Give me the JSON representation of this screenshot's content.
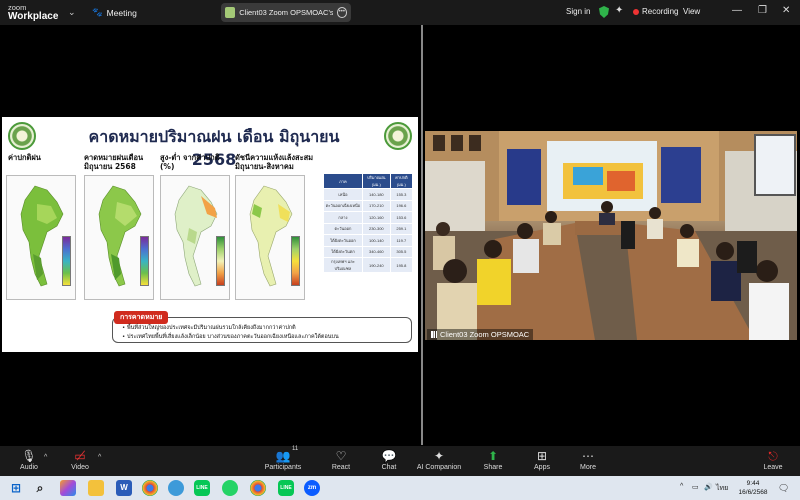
{
  "topbar": {
    "logo_line1": "zoom",
    "logo_line2": "Workplace",
    "meeting_label": "Meeting",
    "share_title": "Client03 Zoom OPSMOAC's scre",
    "signin": "Sign in",
    "recording": "Recording",
    "view": "View"
  },
  "slide": {
    "title": "คาดหมายปริมาณฝน เดือน มิถุนายน 2568",
    "panels": [
      {
        "label": "ค่าปกติฝน"
      },
      {
        "label": "คาดหมายฝนเดือน มิถุนายน 2568"
      },
      {
        "label": "สูง-ต่ำ จากค่าปกติ (%)"
      },
      {
        "label": "ดัชนีความแห้งแล้งสะสม มิถุนายน-สิงหาคม"
      }
    ],
    "table": {
      "headers": [
        "ภาค",
        "ปริมาณฝน (มม.)",
        "ค่าปกติ (มม.)"
      ],
      "rows": [
        [
          "เหนือ",
          "140-180",
          "155.3"
        ],
        [
          "ตะวันออกเฉียงเหนือ",
          "170-210",
          "196.6"
        ],
        [
          "กลาง",
          "120-160",
          "153.6"
        ],
        [
          "ตะวันออก",
          "230-300",
          "259.1"
        ],
        [
          "ใต้ฝั่งตะวันออก",
          "100-140",
          "119.7"
        ],
        [
          "ใต้ฝั่งตะวันตก",
          "340-460",
          "305.5"
        ],
        [
          "กรุงเทพฯ และปริมณฑล",
          "190-240",
          "195.8"
        ]
      ]
    },
    "forecast_tag": "การคาดหมาย",
    "forecast_line1": "• พื้นที่ส่วนใหญ่ของประเทศจะมีปริมาณฝนรวมใกล้เคียงถึงมากกว่าค่าปกติ",
    "forecast_line2": "• ประเทศไทยพื้นที่เสี่ยงแล้งเล็กน้อย บางส่วนของภาคตะวันออกเฉียงเหนือและภาคใต้ตอนบน"
  },
  "camera": {
    "participant_name": "Client03 Zoom OPSMOAC"
  },
  "toolbar": {
    "audio": "Audio",
    "video": "Video",
    "participants": "Participants",
    "participants_count": "11",
    "react": "React",
    "chat": "Chat",
    "ai_companion": "AI Companion",
    "share": "Share",
    "apps": "Apps",
    "more": "More",
    "leave": "Leave"
  },
  "taskbar": {
    "lang": "ไทย",
    "time": "9:44",
    "date": "16/6/2568"
  },
  "colors": {
    "share_green": "#2fb34a",
    "record_red": "#e33333",
    "leave_red": "#e02828"
  }
}
